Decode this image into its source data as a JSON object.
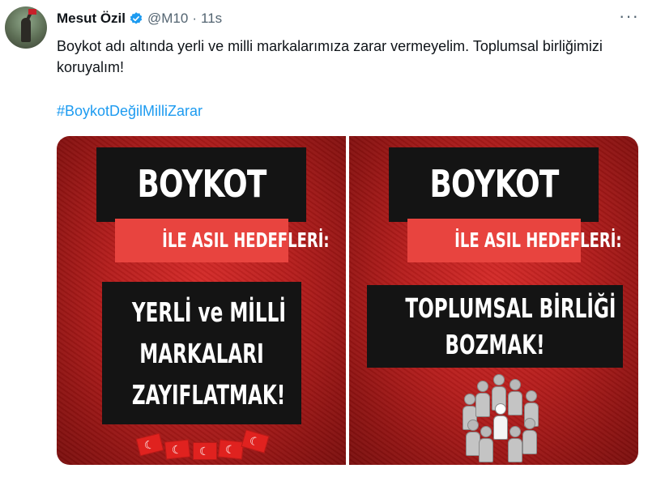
{
  "tweet": {
    "author_name": "Mesut Özil",
    "handle": "@M10",
    "separator": "·",
    "time": "11s",
    "more_label": "···",
    "text": "Boykot adı altında yerli ve milli markalarımıza zarar vermeyelim. Toplumsal birliğimizi koruyalım!",
    "hashtag": "#BoykotDeğilMilliZarar"
  },
  "icons": {
    "verified": "verified-badge-icon",
    "more": "more-options-icon",
    "avatar": "profile-avatar"
  },
  "colors": {
    "link": "#1d9bf0",
    "verified": "#1d9bf0",
    "panel_red": "#c0201f",
    "subtitle_red": "#e8443f",
    "text_box": "#141414"
  },
  "images": [
    {
      "title": "BOYKOT",
      "subtitle": "İLE ASIL HEDEFLERİ:",
      "main_lines": [
        "YERLİ ve MİLLİ",
        "MARKALARI",
        "ZAYIFLATMAK!"
      ]
    },
    {
      "title": "BOYKOT",
      "subtitle": "İLE ASIL HEDEFLERİ:",
      "main_lines": [
        "TOPLUMSAL BİRLİĞİ",
        "BOZMAK!"
      ]
    }
  ]
}
